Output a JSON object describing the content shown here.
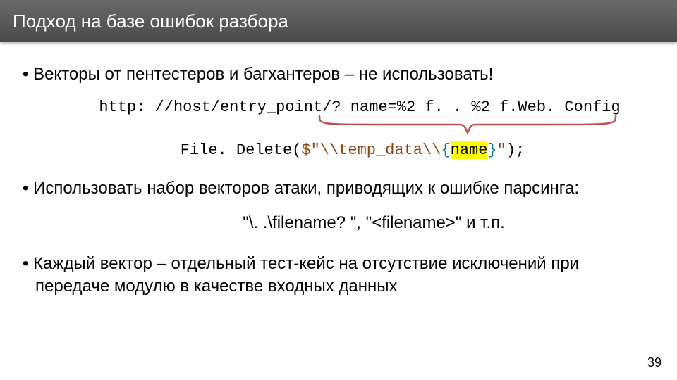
{
  "header": {
    "title": "Подход на базе ошибок разбора"
  },
  "bullet1": "Векторы от пентестеров и багхантеров – не использовать!",
  "url": "http: //host/entry_point/? name=%2 f. . %2 f.Web. Config",
  "code": {
    "p1": "File. Delete",
    "p2": "(",
    "p3": "$\"",
    "p4": "\\\\temp_data\\\\",
    "p5": "{",
    "p6": "name",
    "p7": "}",
    "p8": "\"",
    "p9": ");"
  },
  "bullet2": "Использовать набор векторов атаки, приводящих к ошибке парсинга:",
  "examples": "\"\\. .\\filename? \", \"<filename>\" и т.п.",
  "bullet3": "Каждый вектор – отдельный тест-кейс на отсутствие исключений при передаче модулю в качестве входных данных",
  "page": "39"
}
